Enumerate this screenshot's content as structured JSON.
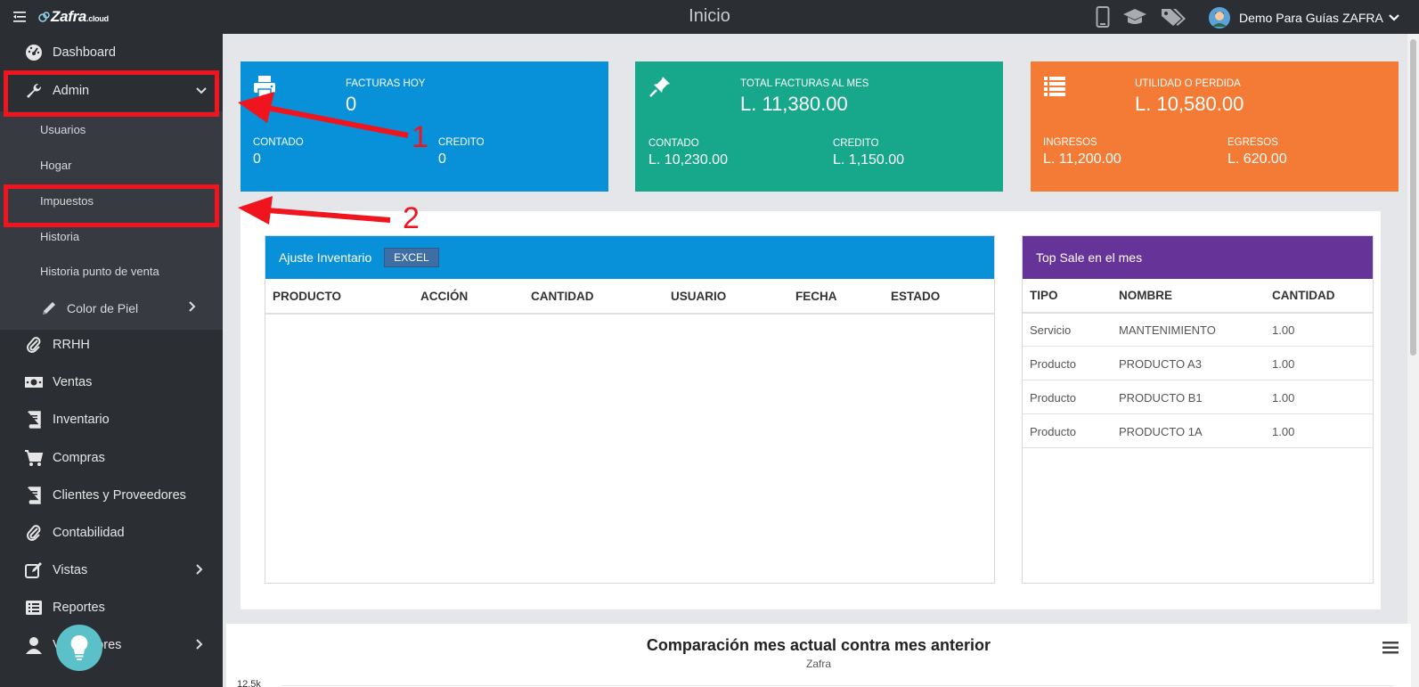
{
  "app": {
    "brand": "Zafra",
    "brand_suffix": ".cloud",
    "page_title": "Inicio",
    "user_name": "Demo Para Guías ZAFRA"
  },
  "topbar_icons": [
    "mobile-icon",
    "graduation-cap-icon",
    "tags-icon"
  ],
  "sidebar": {
    "items": [
      {
        "label": "Dashboard",
        "icon": "dashboard-icon"
      },
      {
        "label": "Admin",
        "icon": "wrench-icon"
      },
      {
        "label": "RRHH",
        "icon": "paperclip-icon"
      },
      {
        "label": "Ventas",
        "icon": "money-icon"
      },
      {
        "label": "Inventario",
        "icon": "book-icon"
      },
      {
        "label": "Compras",
        "icon": "cart-icon"
      },
      {
        "label": "Clientes y Proveedores",
        "icon": "book-icon"
      },
      {
        "label": "Contabilidad",
        "icon": "paperclip-icon"
      },
      {
        "label": "Vistas",
        "icon": "edit-icon"
      },
      {
        "label": "Reportes",
        "icon": "list-icon"
      },
      {
        "label": "Vendedores",
        "icon": "user-icon"
      }
    ],
    "admin_sub": [
      "Usuarios",
      "Hogar",
      "Impuestos",
      "Historia",
      "Historia punto de venta",
      "Color de Piel"
    ]
  },
  "cards": [
    {
      "title": "FACTURAS HOY",
      "value": "0",
      "l1": "CONTADO",
      "v1": "0",
      "l2": "CREDITO",
      "v2": "0",
      "color": "#0891d8",
      "icon": "print-icon"
    },
    {
      "title": "TOTAL FACTURAS AL MES",
      "value": "L. 11,380.00",
      "l1": "CONTADO",
      "v1": "L. 10,230.00",
      "l2": "CREDITO",
      "v2": "L. 1,150.00",
      "color": "#17a88b",
      "icon": "pin-icon"
    },
    {
      "title": "UTILIDAD O PERDIDA",
      "value": "L. 10,580.00",
      "l1": "INGRESOS",
      "v1": "L. 11,200.00",
      "l2": "EGRESOS",
      "v2": "L. 620.00",
      "color": "#f47b35",
      "icon": "list-icon"
    }
  ],
  "inventory": {
    "title": "Ajuste Inventario",
    "excel": "EXCEL",
    "columns": [
      "PRODUCTO",
      "ACCIÓN",
      "CANTIDAD",
      "USUARIO",
      "FECHA",
      "ESTADO"
    ]
  },
  "topsale": {
    "title": "Top Sale en el mes",
    "columns": [
      "TIPO",
      "NOMBRE",
      "CANTIDAD"
    ],
    "rows": [
      [
        "Servicio",
        "MANTENIMIENTO",
        "1.00"
      ],
      [
        "Producto",
        "PRODUCTO A3",
        "1.00"
      ],
      [
        "Producto",
        "PRODUCTO B1",
        "1.00"
      ],
      [
        "Producto",
        "PRODUCTO 1A",
        "1.00"
      ]
    ]
  },
  "chart": {
    "title": "Comparación mes actual contra mes anterior",
    "subtitle": "Zafra",
    "ytick": "12.5k"
  },
  "annotations": [
    "1",
    "2"
  ]
}
